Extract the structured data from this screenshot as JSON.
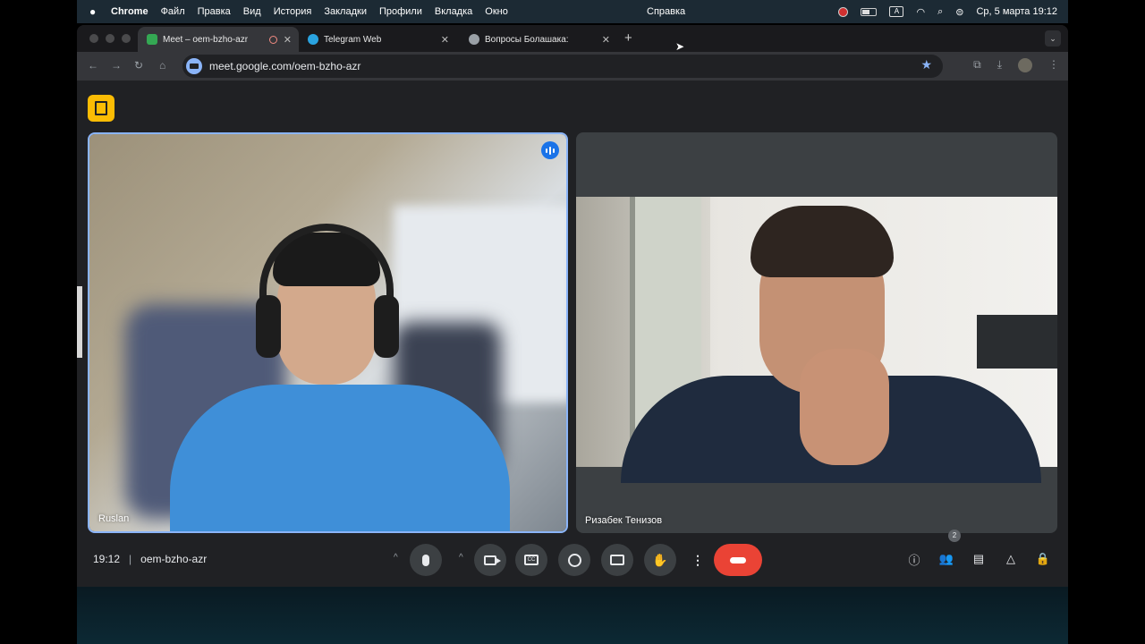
{
  "menubar": {
    "app_name": "Chrome",
    "items": [
      "Файл",
      "Правка",
      "Вид",
      "История",
      "Закладки",
      "Профили",
      "Вкладка",
      "Окно"
    ],
    "center_item": "Справка",
    "datetime": "Ср, 5 марта  19:12"
  },
  "browser": {
    "tabs": [
      {
        "title": "Meet – oem-bzho-azr",
        "active": true
      },
      {
        "title": "Telegram Web",
        "active": false
      },
      {
        "title": "Вопросы Болашака:",
        "active": false
      }
    ],
    "url": "meet.google.com/oem-bzho-azr"
  },
  "meet": {
    "participants": [
      {
        "name": "Ruslan",
        "speaking": true
      },
      {
        "name": "Ризабек Тенизов",
        "speaking": false
      }
    ],
    "time": "19:12",
    "meeting_code": "oem-bzho-azr",
    "people_count": "2"
  },
  "colors": {
    "accent": "#8ab4f8",
    "hangup": "#ea4335",
    "host_badge": "#fbbc04",
    "speaking": "#1a73e8"
  },
  "icons": {
    "controls": [
      "mic-icon",
      "camera-icon",
      "captions-icon",
      "emoji-icon",
      "present-icon",
      "raise-hand-icon",
      "more-options-icon",
      "hangup-icon"
    ],
    "right_controls": [
      "info-icon",
      "people-icon",
      "chat-icon",
      "activities-icon",
      "host-controls-icon"
    ]
  }
}
